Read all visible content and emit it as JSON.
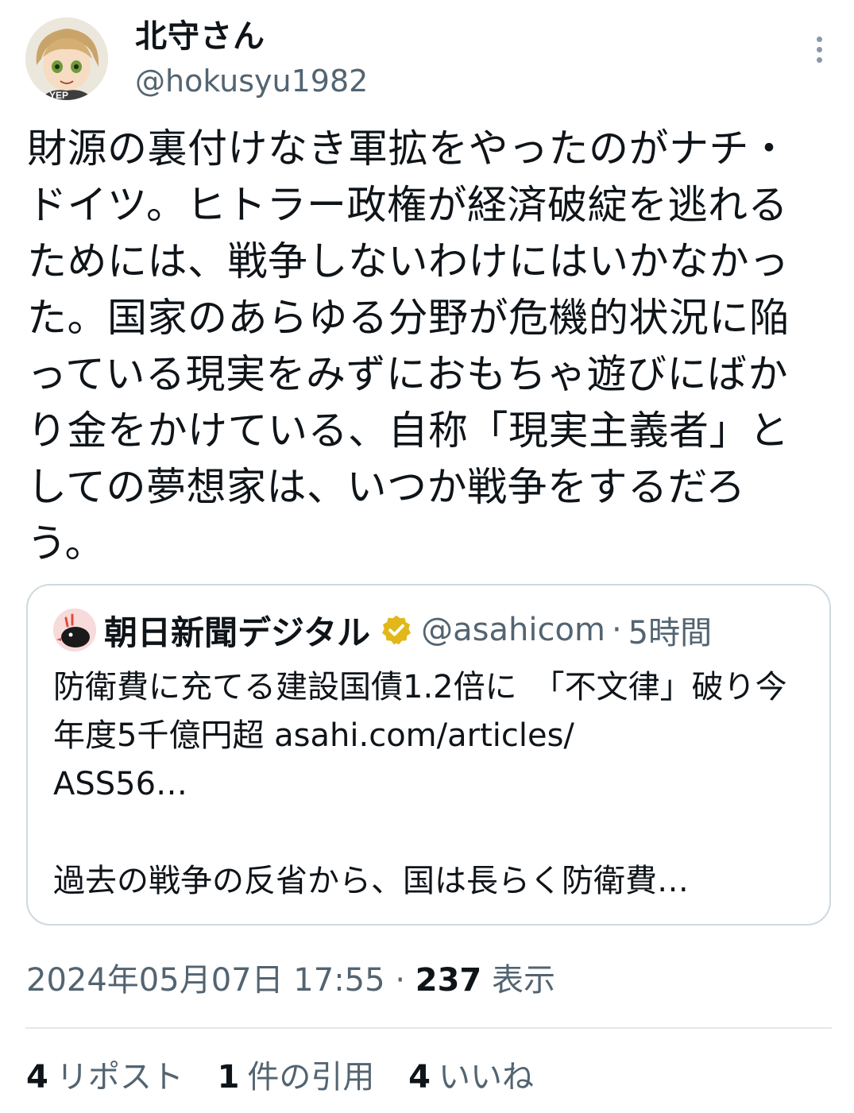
{
  "user": {
    "display_name": "北守さん",
    "handle": "@hokusyu1982",
    "avatar_badge_text": "YEP",
    "avatar_icon": "anime-avatar"
  },
  "menu_icon": "more-vertical-icon",
  "tweet": {
    "text": "財源の裏付けなき軍拡をやったのがナチ・ドイツ。ヒトラー政権が経済破綻を逃れるためには、戦争しないわけにはいかなかった。国家のあらゆる分野が危機的状況に陥っている現実をみずにおもちゃ遊びにばかり金をかけている、自称「現実主義者」としての夢想家は、いつか戦争をするだろう。"
  },
  "quote": {
    "display_name": "朝日新聞デジタル",
    "verified_icon": "verified-badge-icon",
    "handle": "@asahicom",
    "separator": "·",
    "time": "5時間",
    "body": "防衛費に充てる建設国債1.2倍に　「不文律」破り今年度5千億円超 asahi.com/articles/\nASS56…\n\n過去の戦争の反省から、国は長らく防衛費…"
  },
  "meta": {
    "timestamp": "2024年05月07日 17:55",
    "separator": "·",
    "views_count": "237",
    "views_label": "表示"
  },
  "stats": [
    {
      "count": "4",
      "label": "リポスト"
    },
    {
      "count": "1",
      "label": "件の引用"
    },
    {
      "count": "4",
      "label": "いいね"
    }
  ],
  "colors": {
    "text": "#0f1419",
    "secondary": "#536471",
    "border": "#cfd9de",
    "verified_gold": "#e2b719"
  }
}
